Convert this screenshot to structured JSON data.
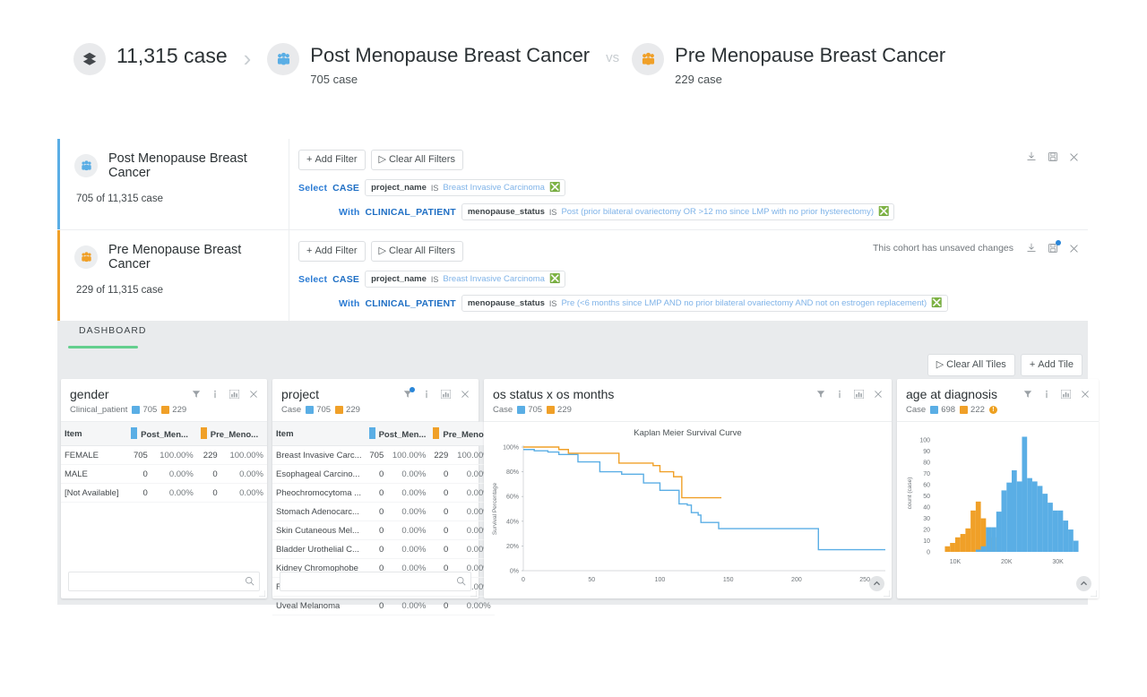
{
  "breadcrumb": {
    "total": {
      "label": "11,315 case",
      "icon": "layers-icon"
    },
    "cohort_a": {
      "title": "Post Menopause Breast Cancer",
      "sub": "705 case",
      "color": "#5aaee5"
    },
    "vs_label": "vs",
    "cohort_b": {
      "title": "Pre Menopause Breast Cancer",
      "sub": "229 case",
      "color": "#f0a028"
    }
  },
  "cohorts": [
    {
      "name": "Post Menopause Breast Cancer",
      "count_label": "705 of 11,315 case",
      "accent": "#5aaee5",
      "add_filter": "Add Filter",
      "clear_filters": "Clear All Filters",
      "status": "",
      "unsaved": false,
      "filters": [
        {
          "prefix": "Select",
          "entity": "CASE",
          "field": "project_name",
          "op": "IS",
          "value": "Breast Invasive Carcinoma",
          "indent": false
        },
        {
          "prefix": "With",
          "entity": "CLINICAL_PATIENT",
          "field": "menopause_status",
          "op": "IS",
          "value": "Post (prior bilateral ovariectomy OR >12 mo since LMP with no prior hysterectomy)",
          "indent": true
        }
      ]
    },
    {
      "name": "Pre Menopause Breast Cancer",
      "count_label": "229 of 11,315 case",
      "accent": "#f0a028",
      "add_filter": "Add Filter",
      "clear_filters": "Clear All Filters",
      "status": "This cohort has unsaved changes",
      "unsaved": true,
      "filters": [
        {
          "prefix": "Select",
          "entity": "CASE",
          "field": "project_name",
          "op": "IS",
          "value": "Breast Invasive Carcinoma",
          "indent": false
        },
        {
          "prefix": "With",
          "entity": "CLINICAL_PATIENT",
          "field": "menopause_status",
          "op": "IS",
          "value": "Pre (<6 months since LMP AND no prior bilateral ovariectomy AND not on estrogen replacement)",
          "indent": true
        }
      ]
    }
  ],
  "tabs": {
    "dashboard": "DASHBOARD"
  },
  "toolbar": {
    "clear_all_tiles": "Clear All Tiles",
    "add_tile": "Add Tile"
  },
  "colors": {
    "blue": "#5aaee5",
    "orange": "#f0a028",
    "overlap": "#4f6b1e",
    "green": "#64cf8e",
    "link": "#2a7bd4"
  },
  "tiles": {
    "gender": {
      "title": "gender",
      "scope": "Clinical_patient",
      "legend": [
        {
          "color": "#5aaee5",
          "value": "705"
        },
        {
          "color": "#f0a028",
          "value": "229"
        }
      ],
      "columns": [
        "Item",
        "Post_Men...",
        "Pre_Meno..."
      ],
      "rows": [
        {
          "item": "FEMALE",
          "a_n": "705",
          "a_p": "100.00%",
          "b_n": "229",
          "b_p": "100.00%"
        },
        {
          "item": "MALE",
          "a_n": "0",
          "a_p": "0.00%",
          "b_n": "0",
          "b_p": "0.00%"
        },
        {
          "item": "[Not Available]",
          "a_n": "0",
          "a_p": "0.00%",
          "b_n": "0",
          "b_p": "0.00%"
        }
      ],
      "search_placeholder": ""
    },
    "project": {
      "title": "project",
      "scope": "Case",
      "legend": [
        {
          "color": "#5aaee5",
          "value": "705"
        },
        {
          "color": "#f0a028",
          "value": "229"
        }
      ],
      "filter_badge": true,
      "columns": [
        "Item",
        "Post_Men...",
        "Pre_Meno..."
      ],
      "rows": [
        {
          "item": "Breast Invasive Carc...",
          "a_n": "705",
          "a_p": "100.00%",
          "b_n": "229",
          "b_p": "100.00%"
        },
        {
          "item": "Esophageal Carcino...",
          "a_n": "0",
          "a_p": "0.00%",
          "b_n": "0",
          "b_p": "0.00%"
        },
        {
          "item": "Pheochromocytoma ...",
          "a_n": "0",
          "a_p": "0.00%",
          "b_n": "0",
          "b_p": "0.00%"
        },
        {
          "item": "Stomach Adenocarc...",
          "a_n": "0",
          "a_p": "0.00%",
          "b_n": "0",
          "b_p": "0.00%"
        },
        {
          "item": "Skin Cutaneous Mel...",
          "a_n": "0",
          "a_p": "0.00%",
          "b_n": "0",
          "b_p": "0.00%"
        },
        {
          "item": "Bladder Urothelial C...",
          "a_n": "0",
          "a_p": "0.00%",
          "b_n": "0",
          "b_p": "0.00%"
        },
        {
          "item": "Kidney Chromophobe",
          "a_n": "0",
          "a_p": "0.00%",
          "b_n": "0",
          "b_p": "0.00%"
        },
        {
          "item": "Rectum Adenocarci...",
          "a_n": "0",
          "a_p": "0.00%",
          "b_n": "0",
          "b_p": "0.00%"
        },
        {
          "item": "Uveal Melanoma",
          "a_n": "0",
          "a_p": "0.00%",
          "b_n": "0",
          "b_p": "0.00%"
        }
      ],
      "search_placeholder": ""
    },
    "survival": {
      "title": "os status x os months",
      "scope": "Case",
      "legend": [
        {
          "color": "#5aaee5",
          "value": "705"
        },
        {
          "color": "#f0a028",
          "value": "229"
        }
      ]
    },
    "age": {
      "title": "age at diagnosis",
      "scope": "Case",
      "legend": [
        {
          "color": "#5aaee5",
          "value": "698"
        },
        {
          "color": "#f0a028",
          "value": "222"
        }
      ],
      "warning": true
    }
  },
  "chart_data": [
    {
      "type": "line",
      "title": "Kaplan Meier Survival Curve",
      "xlabel": "",
      "ylabel": "Survival Percentage",
      "xlim": [
        0,
        265
      ],
      "ylim": [
        0,
        100
      ],
      "xticks": [
        0,
        50,
        100,
        150,
        200,
        250
      ],
      "yticks": [
        "0%",
        "20%",
        "40%",
        "60%",
        "80%",
        "100%"
      ],
      "grid": false,
      "legend_position": "none",
      "series": [
        {
          "name": "Post Menopause Breast Cancer",
          "color": "#5aaee5",
          "points": [
            [
              0,
              98
            ],
            [
              8,
              97
            ],
            [
              18,
              96
            ],
            [
              26,
              94
            ],
            [
              40,
              88
            ],
            [
              56,
              80
            ],
            [
              72,
              78
            ],
            [
              88,
              71
            ],
            [
              100,
              65
            ],
            [
              110,
              65
            ],
            [
              114,
              54
            ],
            [
              120,
              53
            ],
            [
              123,
              47
            ],
            [
              128,
              45
            ],
            [
              130,
              39
            ],
            [
              142,
              39
            ],
            [
              143,
              34
            ],
            [
              215,
              34
            ],
            [
              216,
              17
            ],
            [
              265,
              17
            ]
          ]
        },
        {
          "name": "Pre Menopause Breast Cancer",
          "color": "#f0a028",
          "points": [
            [
              0,
              100
            ],
            [
              24,
              100
            ],
            [
              26,
              98
            ],
            [
              33,
              95
            ],
            [
              56,
              95
            ],
            [
              70,
              87
            ],
            [
              90,
              87
            ],
            [
              95,
              85
            ],
            [
              100,
              80
            ],
            [
              108,
              80
            ],
            [
              110,
              76
            ],
            [
              114,
              76
            ],
            [
              116,
              59
            ],
            [
              145,
              59
            ]
          ]
        }
      ]
    },
    {
      "type": "bar",
      "subtype": "histogram",
      "title": "",
      "xlabel": "",
      "ylabel": "count (case)",
      "xlim": [
        6000,
        36000
      ],
      "ylim": [
        0,
        105
      ],
      "xticks": [
        10000,
        20000,
        30000
      ],
      "xticklabels": [
        "10K",
        "20K",
        "30K"
      ],
      "yticks": [
        0,
        10,
        20,
        30,
        40,
        50,
        60,
        70,
        80,
        90,
        100
      ],
      "bin_width": 1000,
      "grid": false,
      "legend_position": "none",
      "series": [
        {
          "name": "Pre Menopause Breast Cancer",
          "color": "#f0a028",
          "bins": [
            8500,
            9500,
            10500,
            11500,
            12500,
            13500,
            14500,
            15500,
            16500,
            17500,
            18500
          ],
          "values": [
            5,
            8,
            13,
            16,
            21,
            37,
            45,
            30,
            22,
            13,
            4
          ]
        },
        {
          "name": "Post Menopause Breast Cancer",
          "color": "#5aaee5",
          "bins": [
            14500,
            15500,
            16500,
            17500,
            18500,
            19500,
            20500,
            21500,
            22500,
            23500,
            24500,
            25500,
            26500,
            27500,
            28500,
            29500,
            30500,
            31500,
            32500,
            33500
          ],
          "values": [
            2,
            5,
            22,
            22,
            36,
            55,
            62,
            73,
            63,
            103,
            66,
            63,
            59,
            52,
            44,
            37,
            37,
            28,
            20,
            10
          ]
        }
      ]
    }
  ]
}
